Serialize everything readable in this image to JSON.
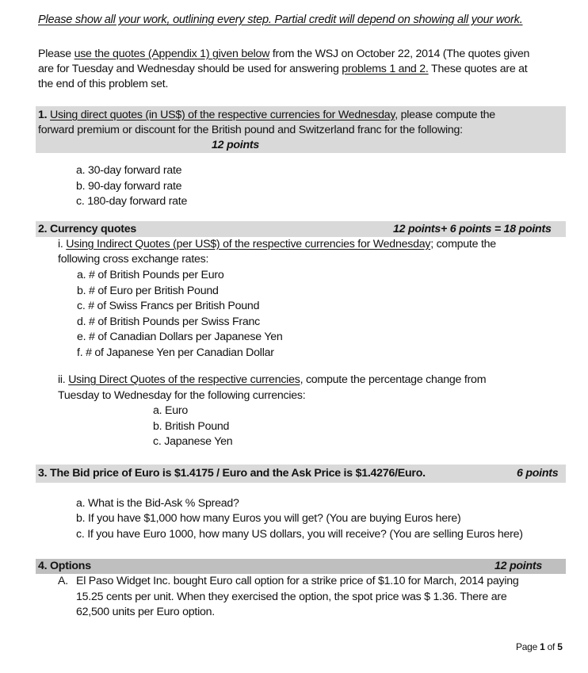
{
  "instruction": "Please show all your work, outlining every step. Partial credit will depend on showing all your work.",
  "intro": {
    "pre": "Please ",
    "link": "use the quotes (Appendix 1) given below",
    "mid": " from the WSJ on October 22, 2014 (The quotes given",
    "line2_pre": "are for Tuesday and Wednesday should be used for answering ",
    "line2_link": "problems 1 and 2.",
    "line2_post": " These quotes are at",
    "line3": "the end of this problem set."
  },
  "q1": {
    "number": "1.",
    "underlined": "Using direct quotes (in US$) of the respective currencies for Wednesday",
    "rest": ", please compute the",
    "line2": "forward premium or discount for the British pound and Switzerland franc for the following:",
    "points": "12 points",
    "items": [
      "a. 30-day forward rate",
      "b. 90-day forward rate",
      "c. 180-day forward rate"
    ]
  },
  "q2": {
    "title": "2. Currency quotes",
    "points": "12 points+ 6 points = 18 points",
    "part_i": {
      "prefix": "i. ",
      "underlined": "Using Indirect Quotes (per US$) of the respective currencies for Wednesday",
      "rest": "; compute the",
      "line2": "following cross exchange rates:",
      "items": [
        "a. # of British Pounds per Euro",
        "b. # of Euro per British Pound",
        "c. # of Swiss Francs per British Pound",
        "d. # of British Pounds per Swiss Franc",
        "e. # of Canadian Dollars per Japanese Yen",
        "f. # of Japanese Yen per Canadian Dollar"
      ]
    },
    "part_ii": {
      "prefix": "ii. ",
      "underlined": "Using Direct Quotes of the respective currencies",
      "rest": ", compute the percentage change from",
      "line2": "Tuesday to Wednesday for the following currencies:",
      "items": [
        "a. Euro",
        "b. British Pound",
        "c. Japanese Yen"
      ]
    }
  },
  "q3": {
    "title": "3. The Bid price of Euro is $1.4175 / Euro and the Ask Price is $1.4276/Euro.",
    "points": "6 points",
    "items": [
      "a. What is the Bid-Ask % Spread?",
      "b. If you have $1,000 how many Euros you will get?  (You are buying Euros here)",
      "c. If you have Euro 1000, how many US dollars, you will receive? (You are selling Euros here)"
    ]
  },
  "q4": {
    "title": "4.  Options",
    "points": "12 points",
    "A": {
      "label": "A.",
      "line1": "El Paso Widget Inc. bought Euro call option for a strike price of $1.10 for March, 2014 paying",
      "line2": "15.25 cents per unit.  When they exercised the option, the spot price was $ 1.36.  There are",
      "line3": "62,500 units per Euro option."
    }
  },
  "footer": {
    "page_word": "Page ",
    "current": "1",
    "of_word": " of ",
    "total": "5"
  }
}
